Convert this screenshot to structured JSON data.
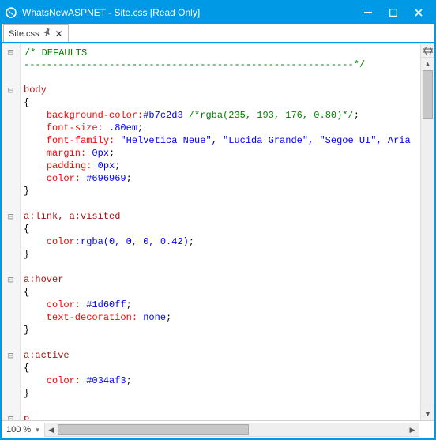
{
  "titlebar": {
    "title": "WhatsNewASPNET - Site.css [Read Only]",
    "min": "▬",
    "max": "☐",
    "close": "✕"
  },
  "tab": {
    "label": "Site.css",
    "pin": "📌",
    "close": "✕"
  },
  "zoom": "100 %",
  "scroll_dropdown": "▾",
  "icons": {
    "split_h": "⇹",
    "arrow_up": "▲",
    "arrow_down": "▼",
    "arrow_left": "◀",
    "arrow_right": "▶"
  },
  "fold_marks": [
    "⊟",
    "",
    "",
    "⊟",
    "",
    "",
    "",
    "",
    "",
    "",
    "",
    "",
    "",
    "⊟",
    "",
    "",
    "",
    "",
    "⊟",
    "",
    "",
    "",
    "",
    "",
    "⊟",
    "",
    "",
    "",
    "",
    "⊟"
  ],
  "code": [
    [
      [
        "comment",
        "/* DEFAULTS"
      ]
    ],
    [
      [
        "comment",
        "----------------------------------------------------------*/"
      ]
    ],
    [],
    [
      [
        "sel",
        "body"
      ]
    ],
    [
      [
        "punc",
        "{"
      ]
    ],
    [
      [
        "prop",
        "    background-color:"
      ],
      [
        "val",
        "#b7c2d3"
      ],
      [
        "punc",
        " "
      ],
      [
        "comment",
        "/*rgba(235, 193, 176, 0.80)*/"
      ],
      [
        "punc",
        ";"
      ]
    ],
    [
      [
        "prop",
        "    font-size:"
      ],
      [
        "val",
        " .80em"
      ],
      [
        "punc",
        ";"
      ]
    ],
    [
      [
        "prop",
        "    font-family:"
      ],
      [
        "val",
        " \"Helvetica Neue\", \"Lucida Grande\", \"Segoe UI\", Aria"
      ]
    ],
    [
      [
        "prop",
        "    margin:"
      ],
      [
        "val",
        " 0px"
      ],
      [
        "punc",
        ";"
      ]
    ],
    [
      [
        "prop",
        "    padding:"
      ],
      [
        "val",
        " 0px"
      ],
      [
        "punc",
        ";"
      ]
    ],
    [
      [
        "prop",
        "    color:"
      ],
      [
        "val",
        " #696969"
      ],
      [
        "punc",
        ";"
      ]
    ],
    [
      [
        "punc",
        "}"
      ]
    ],
    [],
    [
      [
        "sel",
        "a:link, a:visited"
      ]
    ],
    [
      [
        "punc",
        "{"
      ]
    ],
    [
      [
        "prop",
        "    color:"
      ],
      [
        "val",
        "rgba(0, 0, 0, 0.42)"
      ],
      [
        "punc",
        ";"
      ]
    ],
    [
      [
        "punc",
        "}"
      ]
    ],
    [],
    [
      [
        "sel",
        "a:hover"
      ]
    ],
    [
      [
        "punc",
        "{"
      ]
    ],
    [
      [
        "prop",
        "    color:"
      ],
      [
        "val",
        " #1d60ff"
      ],
      [
        "punc",
        ";"
      ]
    ],
    [
      [
        "prop",
        "    text-decoration:"
      ],
      [
        "val",
        " none"
      ],
      [
        "punc",
        ";"
      ]
    ],
    [
      [
        "punc",
        "}"
      ]
    ],
    [],
    [
      [
        "sel",
        "a:active"
      ]
    ],
    [
      [
        "punc",
        "{"
      ]
    ],
    [
      [
        "prop",
        "    color:"
      ],
      [
        "val",
        " #034af3"
      ],
      [
        "punc",
        ";"
      ]
    ],
    [
      [
        "punc",
        "}"
      ]
    ],
    [],
    [
      [
        "sel",
        "p"
      ]
    ]
  ]
}
